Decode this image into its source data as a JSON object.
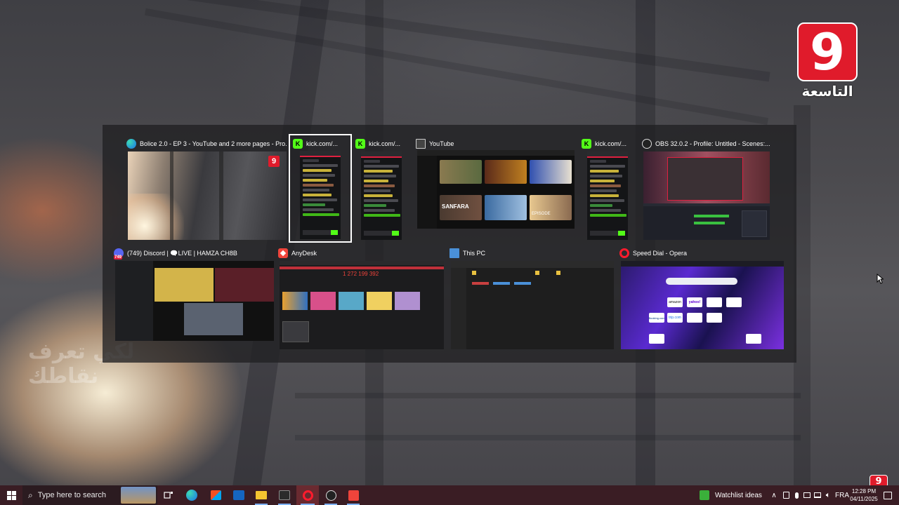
{
  "logo": {
    "numeral": "9",
    "arabic": "التاسعة"
  },
  "watermark_text": "لكي تعرف نقاطك",
  "switcher": {
    "windows": [
      {
        "title": "Bolice 2.0 - EP 3 - YouTube and 2 more pages - Pro...",
        "icon": "edge-icon"
      },
      {
        "title": "kick.com/...",
        "icon": "kick-icon"
      },
      {
        "title": "kick.com/...",
        "icon": "kick-icon"
      },
      {
        "title": "YouTube",
        "icon": "window-icon"
      },
      {
        "title": "kick.com/...",
        "icon": "kick-icon"
      },
      {
        "title": "OBS 32.0.2 - Profile: Untitled - Scenes:...",
        "icon": "obs-icon"
      },
      {
        "title": "(749) Discord | 🗨️LIVE | HAMZA CH8B",
        "icon": "discord-icon",
        "badge": "749"
      },
      {
        "title": "AnyDesk",
        "icon": "anydesk-icon",
        "id_text": "1 272 199 392"
      },
      {
        "title": "This PC",
        "icon": "this-pc-icon"
      },
      {
        "title": "Speed Dial - Opera",
        "icon": "opera-icon"
      }
    ],
    "selected_index": 1
  },
  "thumb_text": {
    "yt_tiles": [
      "SANFARA",
      "EPISODE"
    ],
    "opera_tiles": [
      "amazon",
      "yahoo!",
      "Booking.com",
      "trip.com"
    ]
  },
  "taskbar": {
    "search_placeholder": "Type here to search",
    "weather_label": "Watchlist ideas",
    "language": "FRA",
    "time": "12:28 PM",
    "date": "04/11/2025"
  },
  "colors": {
    "taskbar_bg": "#3a1d24",
    "kick_green": "#53fc18",
    "brand_red": "#e01b2b"
  }
}
